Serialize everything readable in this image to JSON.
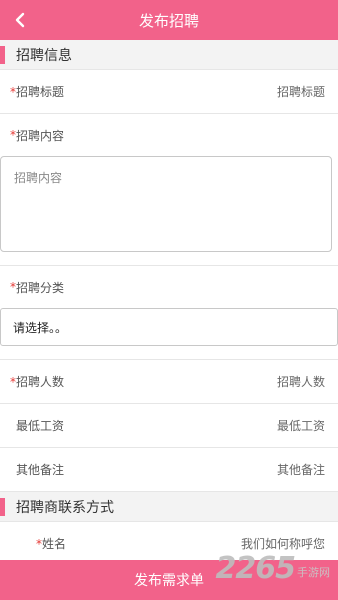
{
  "header": {
    "title": "发布招聘"
  },
  "section1": {
    "title": "招聘信息"
  },
  "title_row": {
    "req": "*",
    "label": "招聘标题",
    "placeholder": "招聘标题"
  },
  "content": {
    "req": "*",
    "label": "招聘内容",
    "placeholder": "招聘内容"
  },
  "category": {
    "req": "*",
    "label": "招聘分类",
    "value": "请选择。。"
  },
  "count_row": {
    "req": "*",
    "label": "招聘人数",
    "placeholder": "招聘人数"
  },
  "salary_row": {
    "label": "最低工资",
    "placeholder": "最低工资"
  },
  "notes_row": {
    "label": "其他备注",
    "placeholder": "其他备注"
  },
  "section2": {
    "title": "招聘商联系方式"
  },
  "name_row": {
    "req": "*",
    "label": "姓名",
    "placeholder": "我们如何称呼您"
  },
  "footer": {
    "submit_label": "发布需求单"
  },
  "watermark": {
    "number": "2265",
    "text": "手游网"
  },
  "colors": {
    "accent": "#f2628a",
    "required": "#e53935"
  }
}
